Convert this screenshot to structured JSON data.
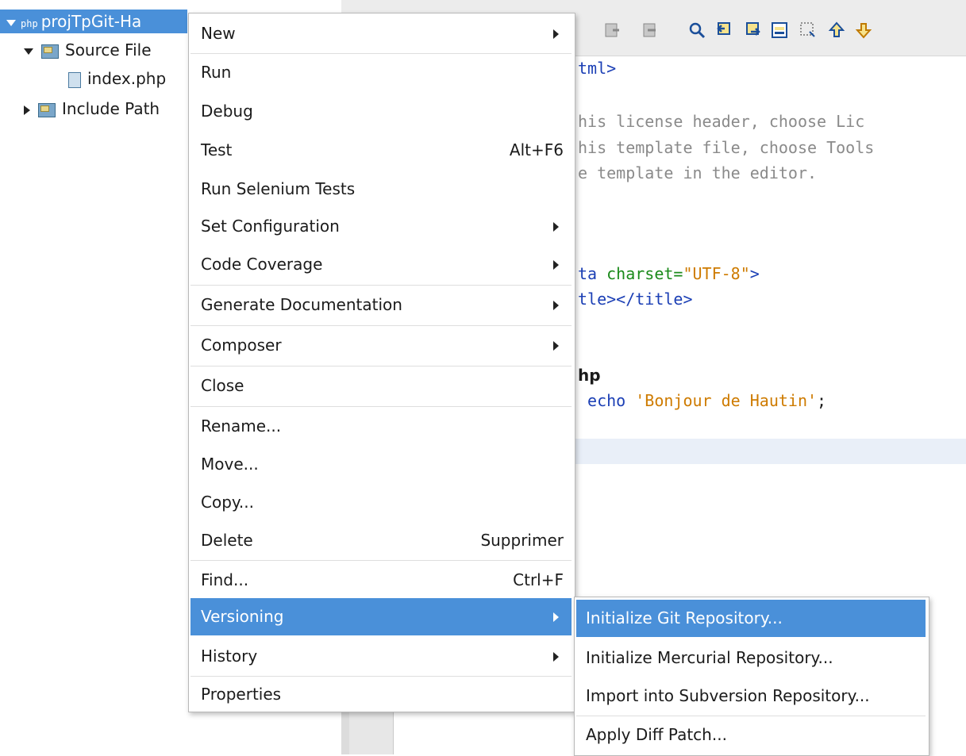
{
  "tree": {
    "project": "projTpGit-Ha",
    "php_tag": "php",
    "source_files": "Source File",
    "index_file": "index.php",
    "include_path": "Include Path"
  },
  "editor": {
    "lines": [
      {
        "parts": [
          {
            "t": "tml>",
            "c": "tag"
          }
        ]
      },
      {
        "parts": [
          {
            "t": "his license header, choose Lic",
            "c": "com"
          }
        ]
      },
      {
        "parts": [
          {
            "t": "his template file, choose Tools",
            "c": "com"
          }
        ]
      },
      {
        "parts": [
          {
            "t": "e template in the editor.",
            "c": "com"
          }
        ]
      },
      {
        "parts": [
          {
            "t": "ta ",
            "c": "tag"
          },
          {
            "t": "charset=",
            "c": "attr"
          },
          {
            "t": "\"UTF-8\"",
            "c": "str"
          },
          {
            "t": ">",
            "c": "tag"
          }
        ]
      },
      {
        "parts": [
          {
            "t": "tle></title>",
            "c": "tag"
          }
        ]
      },
      {
        "parts": [
          {
            "t": "hp",
            "c": "bold"
          }
        ]
      },
      {
        "parts": [
          {
            "t": " echo ",
            "c": "tag"
          },
          {
            "t": "'Bonjour de Hautin'",
            "c": "str"
          },
          {
            "t": ";",
            "c": "plain"
          }
        ]
      }
    ]
  },
  "menu": {
    "items": [
      {
        "label": "New",
        "accel": "",
        "submenu": true
      },
      {
        "label": "Run",
        "accel": "",
        "submenu": false
      },
      {
        "label": "Debug",
        "accel": "",
        "submenu": false
      },
      {
        "label": "Test",
        "accel": "Alt+F6",
        "submenu": false
      },
      {
        "label": "Run Selenium Tests",
        "accel": "",
        "submenu": false
      },
      {
        "label": "Set Configuration",
        "accel": "",
        "submenu": true
      },
      {
        "label": "Code Coverage",
        "accel": "",
        "submenu": true
      },
      {
        "label": "Generate Documentation",
        "accel": "",
        "submenu": true
      },
      {
        "label": "Composer",
        "accel": "",
        "submenu": true
      },
      {
        "label": "Close",
        "accel": "",
        "submenu": false
      },
      {
        "label": "Rename...",
        "accel": "",
        "submenu": false
      },
      {
        "label": "Move...",
        "accel": "",
        "submenu": false
      },
      {
        "label": "Copy...",
        "accel": "",
        "submenu": false
      },
      {
        "label": "Delete",
        "accel": "Supprimer",
        "submenu": false
      },
      {
        "label": "Find...",
        "accel": "Ctrl+F",
        "submenu": false
      },
      {
        "label": "Versioning",
        "accel": "",
        "submenu": true,
        "active": true
      },
      {
        "label": "History",
        "accel": "",
        "submenu": true
      },
      {
        "label": "Properties",
        "accel": "",
        "submenu": false
      }
    ]
  },
  "submenu": {
    "items": [
      {
        "label": "Initialize Git Repository...",
        "active": true
      },
      {
        "label": "Initialize Mercurial Repository..."
      },
      {
        "label": "Import into Subversion Repository..."
      },
      {
        "label": "Apply Diff Patch..."
      }
    ]
  },
  "colors": {
    "selection": "#4a90d9",
    "comment": "#8a8a8a",
    "tag": "#1b3fb5",
    "string": "#ce7b00"
  }
}
